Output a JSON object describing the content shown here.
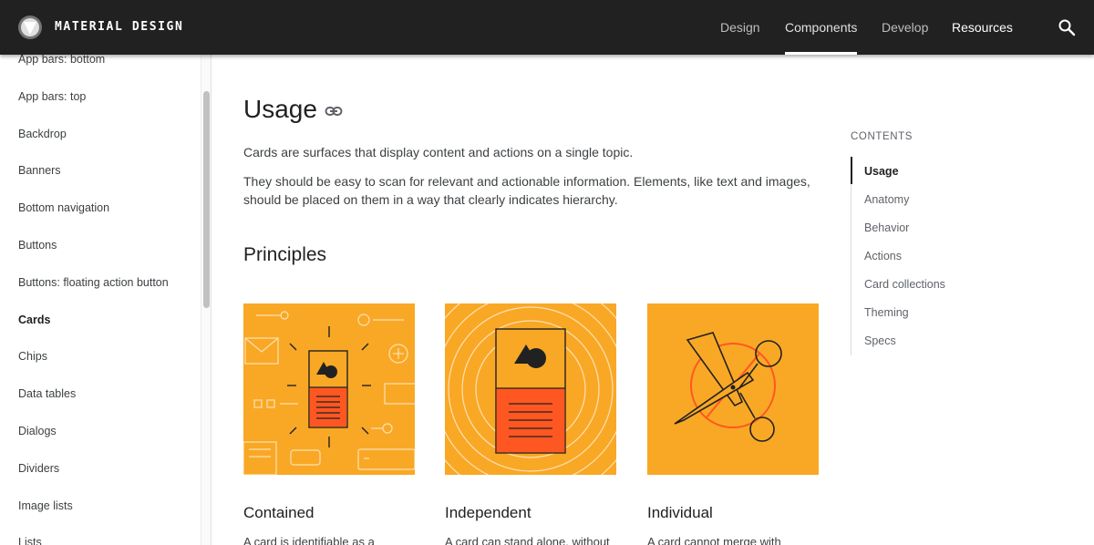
{
  "header": {
    "brand": "MATERIAL DESIGN",
    "nav": [
      {
        "label": "Design"
      },
      {
        "label": "Components"
      },
      {
        "label": "Develop"
      },
      {
        "label": "Resources"
      }
    ],
    "active_nav": "Components"
  },
  "sidebar": {
    "items": [
      {
        "label": "App bars: bottom"
      },
      {
        "label": "App bars: top"
      },
      {
        "label": "Backdrop"
      },
      {
        "label": "Banners"
      },
      {
        "label": "Bottom navigation"
      },
      {
        "label": "Buttons"
      },
      {
        "label": "Buttons: floating action button"
      },
      {
        "label": "Cards"
      },
      {
        "label": "Chips"
      },
      {
        "label": "Data tables"
      },
      {
        "label": "Dialogs"
      },
      {
        "label": "Dividers"
      },
      {
        "label": "Image lists"
      },
      {
        "label": "Lists"
      }
    ],
    "active_item": "Cards"
  },
  "main": {
    "title": "Usage",
    "paragraph1": "Cards are surfaces that display content and actions on a single topic.",
    "paragraph2": "They should be easy to scan for relevant and actionable information. Elements, like text and images, should be placed on them in a way that clearly indicates hierarchy.",
    "section_title": "Principles",
    "cards": [
      {
        "title": "Contained",
        "desc": "A card is identifiable as a"
      },
      {
        "title": "Independent",
        "desc": "A card can stand alone, without"
      },
      {
        "title": "Individual",
        "desc": "A card cannot merge with"
      }
    ]
  },
  "toc": {
    "title": "CONTENTS",
    "items": [
      {
        "label": "Usage"
      },
      {
        "label": "Anatomy"
      },
      {
        "label": "Behavior"
      },
      {
        "label": "Actions"
      },
      {
        "label": "Card collections"
      },
      {
        "label": "Theming"
      },
      {
        "label": "Specs"
      }
    ],
    "active_item": "Usage"
  },
  "colors": {
    "appbar": "#212121",
    "illustration_bg": "#F9A825",
    "illustration_accent": "#FF5722"
  }
}
